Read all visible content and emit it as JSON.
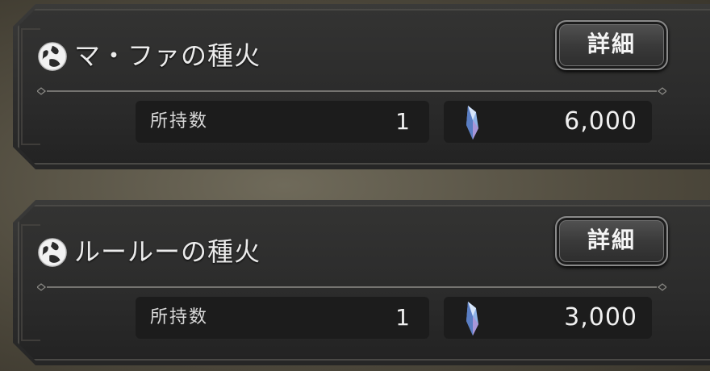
{
  "items": [
    {
      "name": "マ・ファの種火",
      "detail_label": "詳細",
      "count_label": "所持数",
      "count_value": "1",
      "price": "6,000"
    },
    {
      "name": "ルールーの種火",
      "detail_label": "詳細",
      "count_label": "所持数",
      "count_value": "1",
      "price": "3,000"
    }
  ],
  "icons": {
    "item": "globe-emblem-icon",
    "currency": "crystal-icon"
  },
  "colors": {
    "panel": "#2e2e2e",
    "field": "#1c1c1c",
    "text": "#ebebeb",
    "background": "#514c3f"
  }
}
